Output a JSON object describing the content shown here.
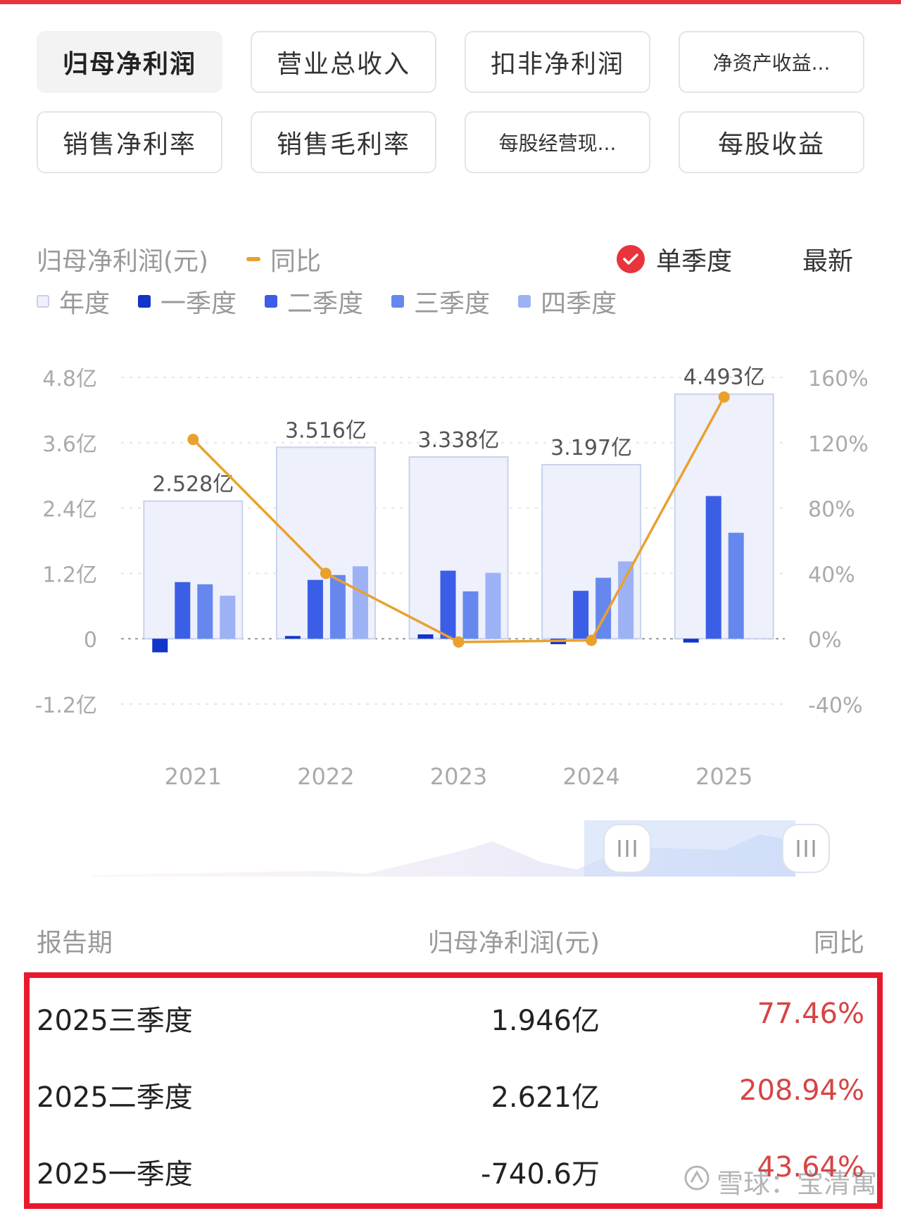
{
  "tabs": [
    {
      "label": "归母净利润",
      "active": true
    },
    {
      "label": "营业总收入",
      "active": false
    },
    {
      "label": "扣非净利润",
      "active": false
    },
    {
      "label": "净资产收益...",
      "active": false,
      "small": true
    },
    {
      "label": "销售净利率",
      "active": false
    },
    {
      "label": "销售毛利率",
      "active": false
    },
    {
      "label": "每股经营现...",
      "active": false,
      "small": true
    },
    {
      "label": "每股收益",
      "active": false
    }
  ],
  "header": {
    "title": "归母净利润(元)",
    "yoy_legend": "同比",
    "single_quarter": "单季度",
    "latest": "最新"
  },
  "legend": [
    {
      "label": "年度",
      "color": "#eef0fb"
    },
    {
      "label": "一季度",
      "color": "#1234c8"
    },
    {
      "label": "二季度",
      "color": "#3a5ee6"
    },
    {
      "label": "三季度",
      "color": "#6688ee"
    },
    {
      "label": "四季度",
      "color": "#9db2f5"
    }
  ],
  "chart_data": {
    "type": "bar",
    "categories": [
      "2021\n年报",
      "2022\n年报",
      "2023\n年报",
      "2024\n年报",
      "2025\n三季报"
    ],
    "annual": {
      "values": [
        2.528,
        3.516,
        3.338,
        3.197,
        4.493
      ],
      "labels": [
        "2.528亿",
        "3.516亿",
        "3.338亿",
        "3.197亿",
        "4.493亿"
      ]
    },
    "series": [
      {
        "name": "一季度",
        "values": [
          -0.25,
          0.05,
          0.08,
          -0.1,
          -0.07
        ],
        "color": "#1234c8"
      },
      {
        "name": "二季度",
        "values": [
          1.04,
          1.08,
          1.25,
          0.88,
          2.621
        ],
        "color": "#3a5ee6"
      },
      {
        "name": "三季度",
        "values": [
          1.0,
          1.17,
          0.87,
          1.12,
          1.946
        ],
        "color": "#6688ee"
      },
      {
        "name": "四季度",
        "values": [
          0.79,
          1.33,
          1.21,
          1.42,
          null
        ],
        "color": "#9db2f5"
      }
    ],
    "yoy": {
      "name": "同比",
      "values": [
        122,
        40,
        -2,
        -1,
        148
      ],
      "color": "#e9a12e"
    },
    "y_left": {
      "ticks": [
        4.8,
        3.6,
        2.4,
        1.2,
        0,
        -1.2
      ],
      "labels": [
        "4.8亿",
        "3.6亿",
        "2.4亿",
        "1.2亿",
        "0",
        "-1.2亿"
      ],
      "range": [
        -1.2,
        4.8
      ]
    },
    "y_right": {
      "ticks": [
        160,
        120,
        80,
        40,
        0,
        -40
      ],
      "labels": [
        "160%",
        "120%",
        "80%",
        "40%",
        "0%",
        "-40%"
      ],
      "range": [
        -40,
        160
      ]
    },
    "annual_color": "#eef0fb",
    "grid": true
  },
  "table": {
    "headers": [
      "报告期",
      "归母净利润(元)",
      "同比"
    ],
    "rows": [
      {
        "period": "2025三季度",
        "value": "1.946亿",
        "yoy": "77.46%"
      },
      {
        "period": "2025二季度",
        "value": "2.621亿",
        "yoy": "208.94%"
      },
      {
        "period": "2025一季度",
        "value": "-740.6万",
        "yoy": "43.64%"
      }
    ]
  },
  "watermark": "雪球：宝清寓",
  "colors": {
    "accent": "#e8343c",
    "positive": "#d64545"
  }
}
